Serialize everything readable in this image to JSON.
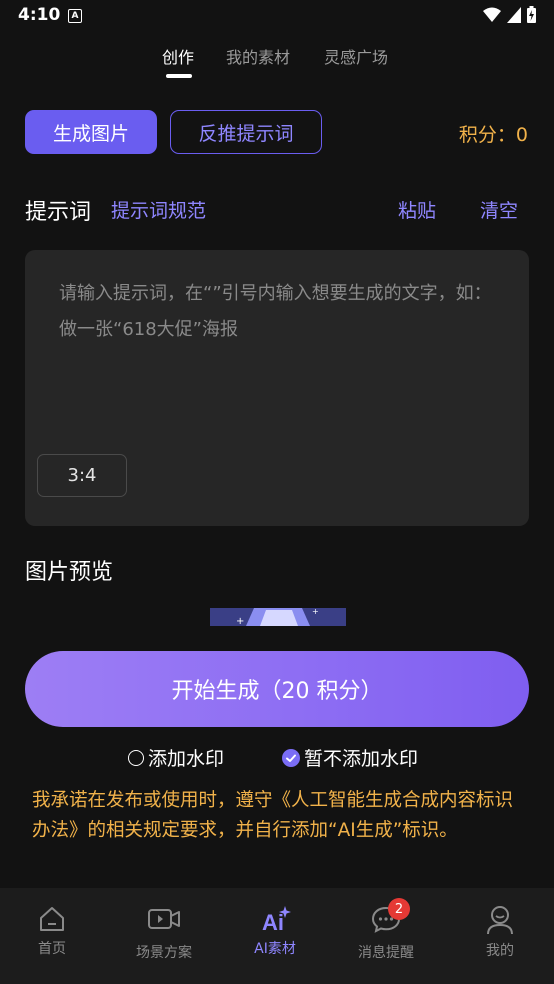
{
  "status_bar": {
    "time": "4:10",
    "notif_letter": "A"
  },
  "top_tabs": [
    {
      "label": "创作",
      "active": true
    },
    {
      "label": "我的素材",
      "active": false
    },
    {
      "label": "灵感广场",
      "active": false
    }
  ],
  "mode": {
    "generate_label": "生成图片",
    "reverse_label": "反推提示词"
  },
  "points_label": "积分：0",
  "prompt": {
    "title": "提示词",
    "rules_link": "提示词规范",
    "paste_label": "粘贴",
    "clear_label": "清空",
    "placeholder": "请输入提示词，在“”引号内输入想要生成的文字，如：做一张“618大促”海报",
    "ratio": "3:4"
  },
  "preview": {
    "title": "图片预览"
  },
  "start_button": "开始生成（20 积分）",
  "watermark": {
    "add_label": "添加水印",
    "no_add_label": "暂不添加水印",
    "selected": "no_add"
  },
  "notice": "我承诺在发布或使用时，遵守《人工智能生成合成内容标识办法》的相关规定要求，并自行添加“AI生成”标识。",
  "bottom_nav": [
    {
      "label": "首页",
      "icon": "home-icon",
      "active": false
    },
    {
      "label": "场景方案",
      "icon": "video-icon",
      "active": false
    },
    {
      "label": "AI素材",
      "icon": "ai-sparkle-icon",
      "active": true
    },
    {
      "label": "消息提醒",
      "icon": "chat-icon",
      "active": false,
      "badge": "2"
    },
    {
      "label": "我的",
      "icon": "user-icon",
      "active": false
    }
  ],
  "colors": {
    "accent": "#6a5df0",
    "accent_text": "#8f86ff",
    "warning": "#f1b24a",
    "badge": "#e53935"
  }
}
